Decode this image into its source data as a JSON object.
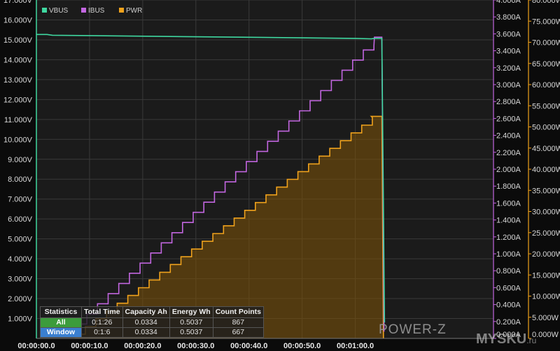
{
  "chart_data": {
    "type": "line",
    "x_axis": {
      "range_seconds": [
        0,
        86
      ],
      "tick_labels": [
        "00:00:00.0",
        "00:00:10.0",
        "00:00:20.0",
        "00:00:30.0",
        "00:00:40.0",
        "00:00:50.0",
        "00:01:00.0"
      ]
    },
    "y_axes": {
      "voltage": {
        "range": [
          0,
          17
        ],
        "tick_labels": [
          "1.000V",
          "2.000V",
          "3.000V",
          "4.000V",
          "5.000V",
          "6.000V",
          "7.000V",
          "8.000V",
          "9.000V",
          "10.000V",
          "11.000V",
          "12.000V",
          "13.000V",
          "14.000V",
          "15.000V",
          "16.000V",
          "17.000V"
        ]
      },
      "current": {
        "range": [
          0,
          4
        ],
        "tick_labels": [
          "0.000A",
          "0.200A",
          "0.400A",
          "0.600A",
          "0.800A",
          "1.000A",
          "1.200A",
          "1.400A",
          "1.600A",
          "1.800A",
          "2.000A",
          "2.200A",
          "2.400A",
          "2.600A",
          "2.800A",
          "3.000A",
          "3.200A",
          "3.400A",
          "3.600A",
          "3.800A",
          "4.000A"
        ]
      },
      "power": {
        "range": [
          0,
          80
        ],
        "tick_labels": [
          "0.000W",
          "5.000W",
          "10.000W",
          "15.000W",
          "20.000W",
          "25.000W",
          "30.000W",
          "35.000W",
          "40.000W",
          "45.000W",
          "50.000W",
          "55.000W",
          "60.000W",
          "65.000W",
          "70.000W",
          "75.000W",
          "80.000W"
        ]
      }
    },
    "series": [
      {
        "name": "VBUS",
        "color": "#3fd8a0",
        "axis": "voltage",
        "points": [
          [
            0,
            15.27
          ],
          [
            2,
            15.27
          ],
          [
            3,
            15.23
          ],
          [
            60,
            15.07
          ],
          [
            63,
            15.05
          ],
          [
            63.5,
            15.07
          ],
          [
            65,
            15.07
          ],
          [
            65.5,
            0.8
          ]
        ]
      },
      {
        "name": "IBUS",
        "color": "#c266e0",
        "axis": "current",
        "steps": {
          "x_start": 5.5,
          "x_step": 2,
          "count": 29,
          "y_start": 0.05,
          "y_step": 0.12,
          "y_end": 3.46
        },
        "points": [
          [
            63.5,
            3.46
          ],
          [
            63.6,
            3.56
          ],
          [
            65,
            3.56
          ],
          [
            65.4,
            0.08
          ]
        ]
      },
      {
        "name": "PWR",
        "color": "#f0a21c",
        "fill": "rgba(120,80,10,0.6)",
        "axis": "power",
        "steps": {
          "x_start": 7.2,
          "x_step": 2,
          "count": 28,
          "y_start": 1.0,
          "y_step": 1.83,
          "y_end": 52.5
        },
        "points": [
          [
            63,
            52.5
          ],
          [
            65,
            52.5
          ],
          [
            65.3,
            0
          ]
        ]
      }
    ],
    "grid": true,
    "legend_position": "top-left"
  },
  "statistics": {
    "headers": [
      "Statistics",
      "Total Time",
      "Capacity Ah",
      "Energy Wh",
      "Count Points"
    ],
    "rows": [
      {
        "label": "All",
        "total_time": "0:1:26",
        "capacity": "0.0334",
        "energy": "0.5037",
        "count": "867"
      },
      {
        "label": "Window",
        "total_time": "0:1:6",
        "capacity": "0.0334",
        "energy": "0.5037",
        "count": "667"
      }
    ]
  },
  "logo_text": "POWER-Z",
  "watermark": "MYSKU",
  "watermark_suffix": ".ru"
}
